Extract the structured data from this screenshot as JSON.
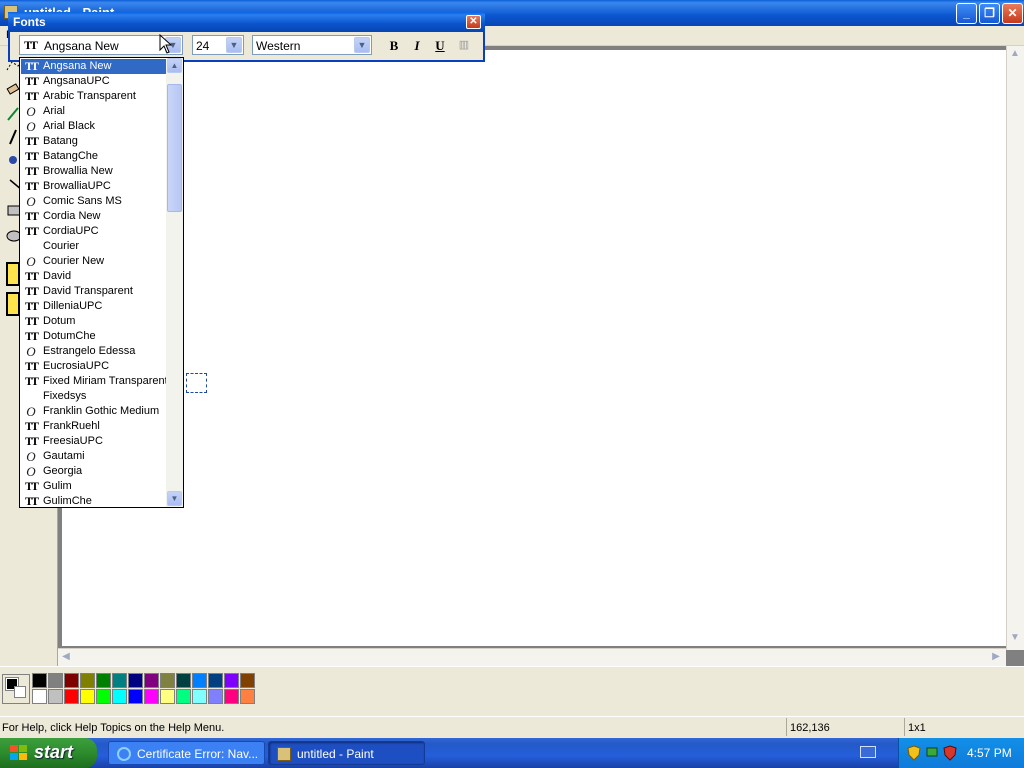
{
  "paint_window": {
    "title": "untitled - Paint",
    "menu_first_letter": "F",
    "caption_minimize": "_",
    "caption_maximize": "❐",
    "caption_close": "✕"
  },
  "fonts_dialog": {
    "title": "Fonts",
    "close_label": "✕",
    "font_name": "Angsana New",
    "font_size": "24",
    "script": "Western",
    "bold_label": "B",
    "italic_label": "I",
    "underline_label": "U",
    "vertical_label": "▥",
    "dropdown_arrow": "▼"
  },
  "font_list": {
    "selected_index": 0,
    "items": [
      {
        "label": "Angsana New",
        "icon": "truetype-icon"
      },
      {
        "label": "AngsanaUPC",
        "icon": "truetype-icon"
      },
      {
        "label": "Arabic Transparent",
        "icon": "truetype-icon"
      },
      {
        "label": "Arial",
        "icon": "opentype-icon"
      },
      {
        "label": "Arial Black",
        "icon": "opentype-icon"
      },
      {
        "label": "Batang",
        "icon": "truetype-icon"
      },
      {
        "label": "BatangChe",
        "icon": "truetype-icon"
      },
      {
        "label": "Browallia New",
        "icon": "truetype-icon"
      },
      {
        "label": "BrowalliaUPC",
        "icon": "truetype-icon"
      },
      {
        "label": "Comic Sans MS",
        "icon": "opentype-icon"
      },
      {
        "label": "Cordia New",
        "icon": "truetype-icon"
      },
      {
        "label": "CordiaUPC",
        "icon": "truetype-icon"
      },
      {
        "label": "Courier",
        "icon": "none"
      },
      {
        "label": "Courier New",
        "icon": "opentype-icon"
      },
      {
        "label": "David",
        "icon": "truetype-icon"
      },
      {
        "label": "David Transparent",
        "icon": "truetype-icon"
      },
      {
        "label": "DilleniaUPC",
        "icon": "truetype-icon"
      },
      {
        "label": "Dotum",
        "icon": "truetype-icon"
      },
      {
        "label": "DotumChe",
        "icon": "truetype-icon"
      },
      {
        "label": "Estrangelo Edessa",
        "icon": "opentype-icon"
      },
      {
        "label": "EucrosiaUPC",
        "icon": "truetype-icon"
      },
      {
        "label": "Fixed Miriam Transparent",
        "icon": "truetype-icon"
      },
      {
        "label": "Fixedsys",
        "icon": "none"
      },
      {
        "label": "Franklin Gothic Medium",
        "icon": "opentype-icon"
      },
      {
        "label": "FrankRuehl",
        "icon": "truetype-icon"
      },
      {
        "label": "FreesiaUPC",
        "icon": "truetype-icon"
      },
      {
        "label": "Gautami",
        "icon": "opentype-icon"
      },
      {
        "label": "Georgia",
        "icon": "opentype-icon"
      },
      {
        "label": "Gulim",
        "icon": "truetype-icon"
      },
      {
        "label": "GulimChe",
        "icon": "truetype-icon"
      }
    ]
  },
  "palette": {
    "foreground": "#000000",
    "background": "#ffffff",
    "row1": [
      "#000000",
      "#808080",
      "#800000",
      "#808000",
      "#008000",
      "#008080",
      "#000080",
      "#800080",
      "#808040",
      "#004040",
      "#0080ff",
      "#004080",
      "#8000ff",
      "#804000"
    ],
    "row2": [
      "#ffffff",
      "#c0c0c0",
      "#ff0000",
      "#ffff00",
      "#00ff00",
      "#00ffff",
      "#0000ff",
      "#ff00ff",
      "#ffff80",
      "#00ff80",
      "#80ffff",
      "#8080ff",
      "#ff0080",
      "#ff8040"
    ]
  },
  "statusbar": {
    "help_text": "For Help, click Help Topics on the Help Menu.",
    "coords": "162,136",
    "size": "1x1"
  },
  "taskbar": {
    "start_label": "start",
    "tasks": [
      {
        "label": "Certificate Error: Nav..."
      },
      {
        "label": "untitled - Paint"
      }
    ],
    "clock": "4:57 PM"
  }
}
